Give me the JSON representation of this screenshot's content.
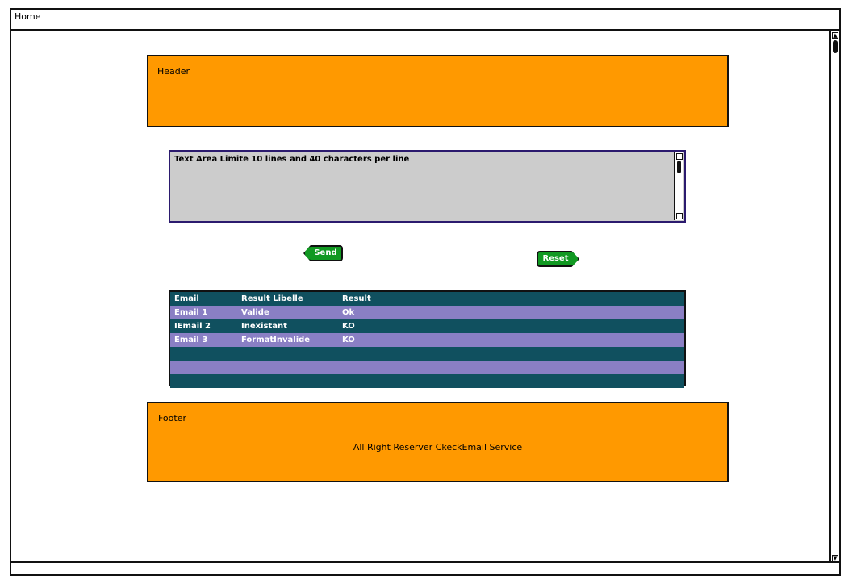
{
  "window": {
    "title": "Home"
  },
  "header": {
    "label": "Header"
  },
  "textarea": {
    "value": "Text Area Limite 10 lines and 40 characters per line"
  },
  "buttons": {
    "send": "Send",
    "reset": "Reset"
  },
  "table": {
    "columns": [
      "Email",
      "Result Libelle",
      "Result"
    ],
    "rows": [
      [
        "Email 1",
        "Valide",
        "Ok"
      ],
      [
        "IEmail 2",
        "Inexistant",
        "KO"
      ],
      [
        "Email 3",
        "FormatInvalide",
        "KO"
      ],
      [
        "",
        "",
        ""
      ],
      [
        "",
        "",
        ""
      ],
      [
        "",
        "",
        ""
      ]
    ]
  },
  "footer": {
    "label": "Footer",
    "copyright": "All Right Reserver CkeckEmail Service"
  },
  "colors": {
    "panel": "#ff9900",
    "button": "#119922",
    "table_dark": "#10505f",
    "table_alt": "#8a7fc4",
    "textarea_bg": "#cccccc"
  }
}
